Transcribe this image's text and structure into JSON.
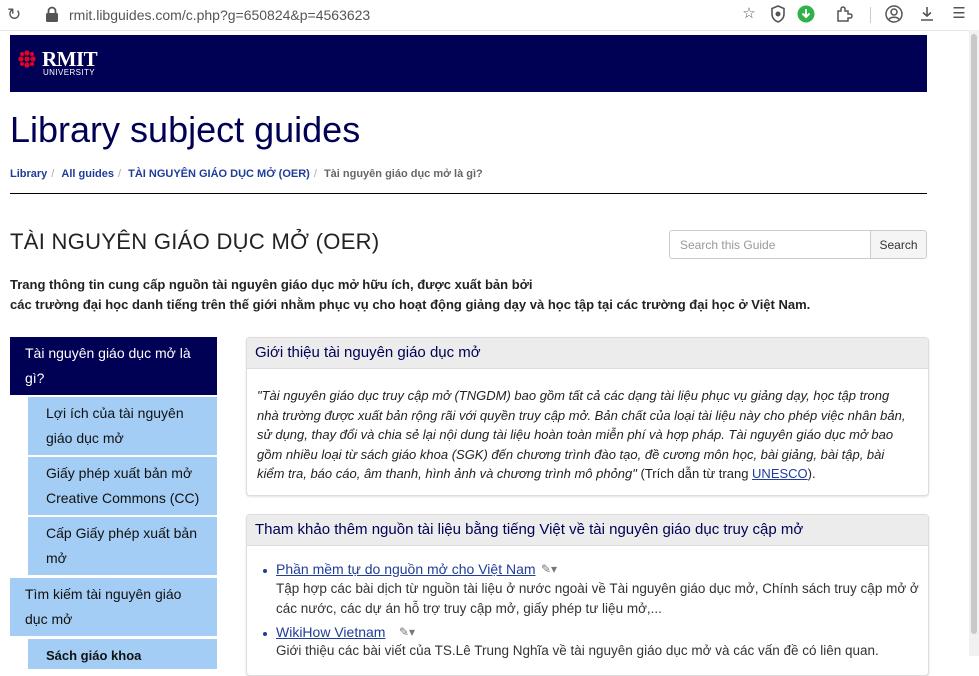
{
  "browser": {
    "url": "rmit.libguides.com/c.php?g=650824&p=4563623"
  },
  "header": {
    "logo_word": "RMIT",
    "logo_sub": "UNIVERSITY",
    "brand_color": "#000054"
  },
  "site_title": "Library subject guides",
  "breadcrumb": {
    "items": [
      "Library",
      "All guides",
      "TÀI NGUYÊN GIÁO DỤC MỞ (OER)"
    ],
    "current": "Tài nguyên giáo dục mở là gì?"
  },
  "guide": {
    "title": "TÀI NGUYÊN GIÁO DỤC MỞ (OER)",
    "description_line1": "Trang thông tin cung cấp nguồn tài nguyên giáo dục mở hữu ích, được xuất bản bởi",
    "description_line2": "các trường đại học danh tiếng trên thế giới nhằm phục vụ cho hoạt động giảng dạy và học tập tại các trường đại học ở Việt Nam."
  },
  "search": {
    "placeholder": "Search this Guide",
    "button_label": "Search"
  },
  "sidebar": {
    "active_line1": "Tài nguyên giáo dục mở là",
    "active_line2": "gì?",
    "sub1_line1": "Lợi ích của tài nguyên",
    "sub1_line2": "giáo dục mở",
    "sub2_line1": "Giấy phép xuất bản mở",
    "sub2_line2": "Creative Commons (CC)",
    "sub3_line1": "Cấp Giấy phép xuất bản",
    "sub3_line2": "mở",
    "top2_line1": "Tìm kiếm tài nguyên giáo",
    "top2_line2": "dục mở",
    "sub4_line1": "Sách giáo khoa"
  },
  "intro_box": {
    "heading": "Giới thiệu tài nguyên giáo dục mở",
    "quote_l1": "\"Tài nguyên giáo dục truy cập mở (TNGDM) bao gồm tất cả các dạng tài liệu phục vụ giảng dạy, học tập trong",
    "quote_l2": "nhà trường được xuất bản rộng rãi với quyền truy cập mở. Bản chất của loại tài liệu này cho phép việc nhân bản,",
    "quote_l3": "sử dụng, thay đổi và chia sẻ lại nội dung tài liệu hoàn toàn miễn phí và hợp pháp. Tài nguyên giáo dục mở bao",
    "quote_l4": "gồm nhiều loại từ sách giáo khoa (SGK) đến chương trình đào tạo, đề cương môn học, bài giảng, bài tập, bài",
    "quote_l5": "kiểm tra, báo cáo, âm thanh, hình ảnh và chương trình mô phỏng\"",
    "citation_text": " (Trích dẫn từ trang ",
    "citation_link": "UNESCO",
    "citation_end": ")."
  },
  "refs_box": {
    "heading": "Tham khảo thêm nguồn tài liệu bằng tiếng Việt về tài nguyên giáo dục truy cập mở",
    "item1_title": "Phần mềm tự do nguồn mở cho Việt Nam",
    "item1_desc_l1": "Tập hợp các bài dịch từ nguồn tài liệu ở nước ngoài về Tài nguyên giáo dục mở, Chính sách truy cập mở ở",
    "item1_desc_l2": "các nước, các dự án hỗ trợ truy cập mở, giấy phép tư liệu mở,...",
    "item2_title": "WikiHow Vietnam",
    "item2_desc_l1": "Giới thiệu các bài viết của TS.Lê Trung Nghĩa về tài nguyên giáo dục mở và các vấn đề có liên quan."
  }
}
